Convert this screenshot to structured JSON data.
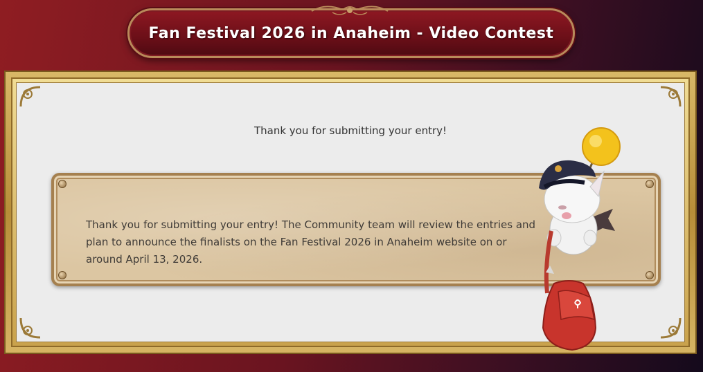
{
  "header": {
    "title": "Fan Festival 2026 in Anaheim - Video Contest"
  },
  "confirmation": {
    "heading": "Thank you for submitting your entry!",
    "message": "Thank you for submitting your entry! The Community team will review the entries and plan to announce the finalists on the Fan Festival 2026 in Anaheim website on or around April 13, 2026."
  },
  "decor": {
    "mascot": "moogle-mail-carrier-illustration",
    "ornament": "title-ornament-icon",
    "colors": {
      "background_red": "#8f1d22",
      "background_dark": "#140a1c",
      "gold_frame": "#c9a24c",
      "panel": "#ececec",
      "parchment": "#dcc6a2",
      "text": "#333333"
    }
  }
}
